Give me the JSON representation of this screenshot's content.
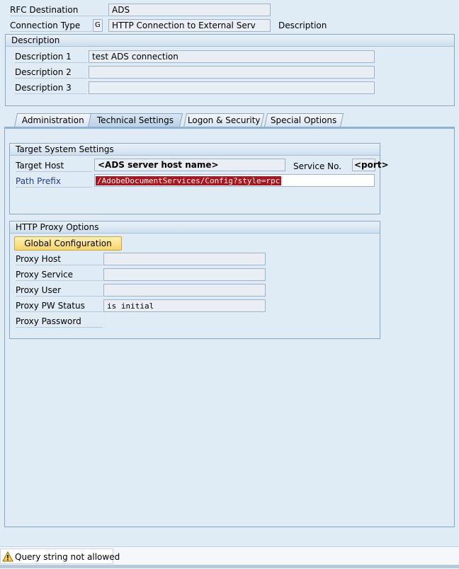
{
  "header": {
    "rfc_destination_label": "RFC Destination",
    "rfc_destination_value": "ADS",
    "connection_type_label": "Connection Type",
    "connection_type_code": "G",
    "connection_type_text": "HTTP Connection to External Serv",
    "description_label": "Description"
  },
  "description_group": {
    "title": "Description",
    "rows": [
      {
        "label": "Description 1",
        "value": "test ADS connection"
      },
      {
        "label": "Description 2",
        "value": ""
      },
      {
        "label": "Description 3",
        "value": ""
      }
    ]
  },
  "tabs": [
    {
      "label": "Administration",
      "active": false
    },
    {
      "label": "Technical Settings",
      "active": true
    },
    {
      "label": "Logon & Security",
      "active": false
    },
    {
      "label": "Special Options",
      "active": false
    }
  ],
  "target_system": {
    "title": "Target System Settings",
    "target_host_label": "Target Host",
    "target_host_value": "<ADS server host name>",
    "service_no_label": "Service No.",
    "service_no_value": "<port>",
    "path_prefix_label": "Path Prefix",
    "path_prefix_value": "/AdobeDocumentServices/Config?style=rpc"
  },
  "proxy": {
    "title": "HTTP Proxy Options",
    "global_config_button": "Global Configuration",
    "host_label": "Proxy Host",
    "host_value": "",
    "service_label": "Proxy Service",
    "service_value": "",
    "user_label": "Proxy User",
    "user_value": "",
    "pw_status_label": "Proxy PW Status",
    "pw_status_value": "is initial",
    "password_label": "Proxy Password"
  },
  "status_bar": {
    "icon": "warning-icon",
    "message": "Query string not allowed"
  },
  "colors": {
    "background": "#dfebf5",
    "highlight_error": "#b0131b",
    "button_yellow": "#fbe38a",
    "link_blue": "#1f3a93"
  }
}
